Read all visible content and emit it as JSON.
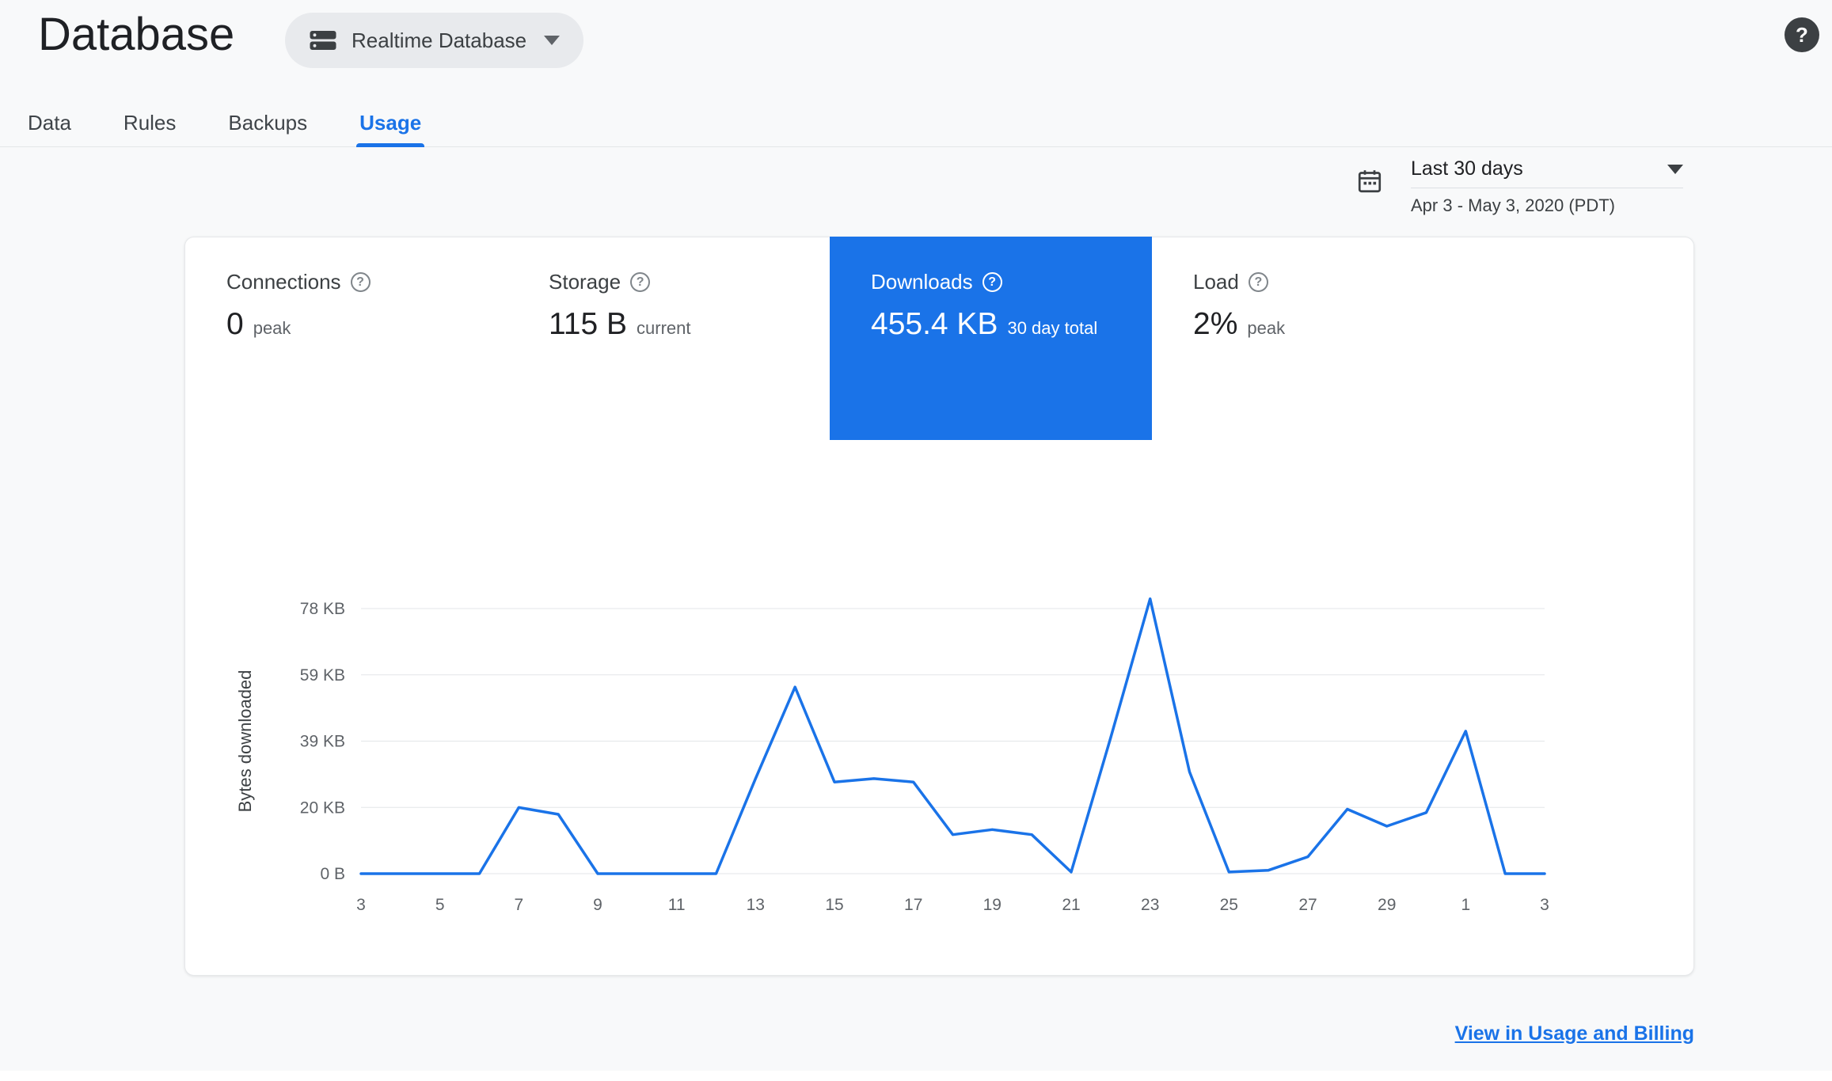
{
  "header": {
    "title": "Database",
    "database_selector": "Realtime Database"
  },
  "icons": {
    "help_glyph": "?"
  },
  "tabs": [
    {
      "label": "Data"
    },
    {
      "label": "Rules"
    },
    {
      "label": "Backups"
    },
    {
      "label": "Usage"
    }
  ],
  "date_range": {
    "selected": "Last 30 days",
    "detail": "Apr 3 - May 3, 2020 (PDT)"
  },
  "metrics": [
    {
      "label": "Connections",
      "value": "0",
      "unit": "peak"
    },
    {
      "label": "Storage",
      "value": "115 B",
      "unit": "current"
    },
    {
      "label": "Downloads",
      "value": "455.4 KB",
      "unit": "30 day total"
    },
    {
      "label": "Load",
      "value": "2%",
      "unit": "peak"
    }
  ],
  "footer": {
    "link_label": "View in Usage and Billing"
  },
  "colors": {
    "accent_blue": "#1a73e8",
    "selected_tile_bg": "#1a73e8",
    "grid_line": "#e3e5e8"
  },
  "chart_data": {
    "type": "line",
    "title": "Downloads",
    "ylabel": "Bytes downloaded",
    "unit": "KB",
    "grid": true,
    "legend": "none",
    "line_color": "#1a73e8",
    "ylim": [
      0,
      85
    ],
    "y_ticks": [
      {
        "label": "0 B",
        "value": 0
      },
      {
        "label": "20 KB",
        "value": 19.53
      },
      {
        "label": "39 KB",
        "value": 39.06
      },
      {
        "label": "59 KB",
        "value": 58.59
      },
      {
        "label": "78 KB",
        "value": 78.13
      }
    ],
    "x_ticks": [
      {
        "index": 0,
        "label": "3"
      },
      {
        "index": 2,
        "label": "5"
      },
      {
        "index": 4,
        "label": "7"
      },
      {
        "index": 6,
        "label": "9"
      },
      {
        "index": 8,
        "label": "11"
      },
      {
        "index": 10,
        "label": "13"
      },
      {
        "index": 12,
        "label": "15"
      },
      {
        "index": 14,
        "label": "17"
      },
      {
        "index": 16,
        "label": "19"
      },
      {
        "index": 18,
        "label": "21"
      },
      {
        "index": 20,
        "label": "23"
      },
      {
        "index": 22,
        "label": "25"
      },
      {
        "index": 24,
        "label": "27"
      },
      {
        "index": 26,
        "label": "29"
      },
      {
        "index": 28,
        "label": "1"
      },
      {
        "index": 30,
        "label": "3"
      }
    ],
    "days": [
      "Apr 3",
      "Apr 4",
      "Apr 5",
      "Apr 6",
      "Apr 7",
      "Apr 8",
      "Apr 9",
      "Apr 10",
      "Apr 11",
      "Apr 12",
      "Apr 13",
      "Apr 14",
      "Apr 15",
      "Apr 16",
      "Apr 17",
      "Apr 18",
      "Apr 19",
      "Apr 20",
      "Apr 21",
      "Apr 22",
      "Apr 23",
      "Apr 24",
      "Apr 25",
      "Apr 26",
      "Apr 27",
      "Apr 28",
      "Apr 29",
      "Apr 30",
      "May 1",
      "May 2",
      "May 3"
    ],
    "values_kb": [
      0,
      0,
      0,
      0,
      19.5,
      17.5,
      0,
      0,
      0,
      0,
      28,
      55,
      27,
      28,
      27,
      11.5,
      13,
      11.5,
      0.5,
      40,
      81,
      30,
      0.5,
      1,
      5,
      19,
      14,
      18,
      42,
      0,
      0
    ]
  }
}
